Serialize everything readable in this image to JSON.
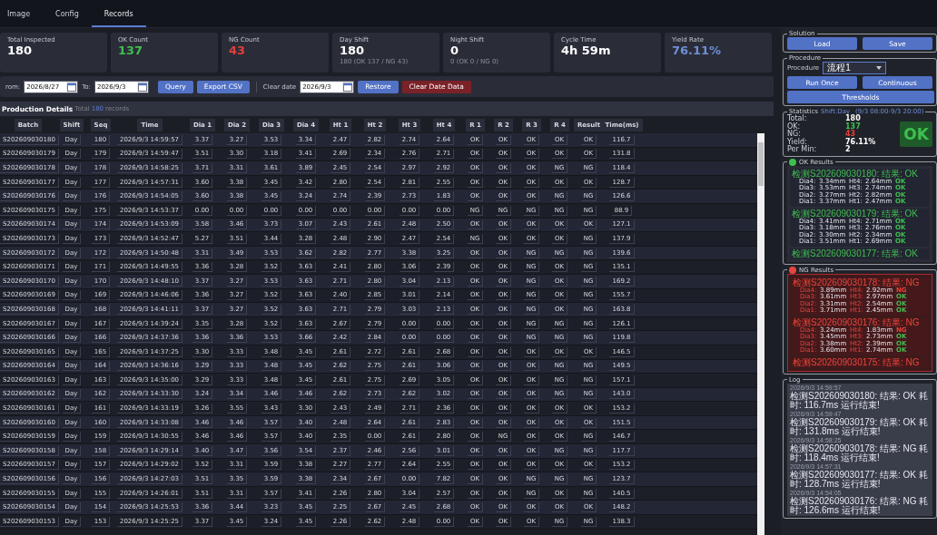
{
  "tabs": [
    {
      "label": "Image",
      "selected": false
    },
    {
      "label": "Config",
      "selected": false
    },
    {
      "label": "Records",
      "selected": true
    }
  ],
  "cards": [
    {
      "label": "Total Inspected",
      "value": "180",
      "kind": "plain"
    },
    {
      "label": "OK Count",
      "value": "137",
      "kind": "ok"
    },
    {
      "label": "NG Count",
      "value": "43",
      "kind": "ng"
    },
    {
      "label": "Day Shift",
      "value": "180",
      "sub": "180 (OK 137 / NG 43)",
      "kind": "plain"
    },
    {
      "label": "Night Shift",
      "value": "0",
      "sub": "0 (OK 0 / NG 0)",
      "kind": "plain"
    },
    {
      "label": "Cycle Time",
      "value": "4h 59m",
      "kind": "plain"
    },
    {
      "label": "Yield Rate",
      "value": "76.11%",
      "kind": "rate"
    }
  ],
  "filter": {
    "from_label": "rom:",
    "from": "2026/8/27",
    "to_label": "To:",
    "to": "2026/9/3",
    "query": "Query",
    "export": "Export CSV",
    "clear_label": "Clear date",
    "clear_date": "2026/9/3",
    "restore": "Restore",
    "clear": "Clear Date Data"
  },
  "details": {
    "title": "Production Details",
    "total_prefix": "Total",
    "total": "180",
    "total_suffix": "records"
  },
  "table": {
    "columns": [
      "Batch",
      "Shift",
      "Seq",
      "Time",
      "Dia 1",
      "Dia 2",
      "Dia 3",
      "Dia 4",
      "Ht 1",
      "Ht 2",
      "Ht 3",
      "Ht 4",
      "R 1",
      "R 2",
      "R 3",
      "R 4",
      "Result",
      "Time(ms)"
    ],
    "rows": [
      {
        "cells": [
          "S202609030180",
          "Day",
          "180",
          "2026/9/3 14:59:57",
          "3.37",
          "3.27",
          "3.53",
          "3.34",
          "2.47",
          "2.82",
          "2.74",
          "2.64",
          "OK",
          "OK",
          "OK",
          "OK",
          "OK",
          "116.7"
        ]
      },
      {
        "cells": [
          "S202609030179",
          "Day",
          "179",
          "2026/9/3 14:59:47",
          "3.51",
          "3.30",
          "3.18",
          "3.41",
          "2.69",
          "2.34",
          "2.76",
          "2.71",
          "OK",
          "OK",
          "OK",
          "OK",
          "OK",
          "131.8"
        ]
      },
      {
        "cells": [
          "S202609030178",
          "Day",
          "178",
          "2026/9/3 14:58:25",
          "3.71",
          "3.31",
          "3.61",
          "3.89",
          "2.45",
          "2.54",
          "2.97",
          "2.92",
          "OK",
          "OK",
          "OK",
          "NG",
          "NG",
          "118.4"
        ]
      },
      {
        "cells": [
          "S202609030177",
          "Day",
          "177",
          "2026/9/3 14:57:31",
          "3.60",
          "3.38",
          "3.45",
          "3.42",
          "2.80",
          "2.54",
          "2.81",
          "2.55",
          "OK",
          "OK",
          "OK",
          "OK",
          "OK",
          "128.7"
        ]
      },
      {
        "cells": [
          "S202609030176",
          "Day",
          "176",
          "2026/9/3 14:54:05",
          "3.60",
          "3.38",
          "3.45",
          "3.24",
          "2.74",
          "2.39",
          "2.73",
          "1.83",
          "OK",
          "OK",
          "OK",
          "NG",
          "NG",
          "126.6"
        ]
      },
      {
        "cells": [
          "S202609030175",
          "Day",
          "175",
          "2026/9/3 14:53:37",
          "0.00",
          "0.00",
          "0.00",
          "0.00",
          "0.00",
          "0.00",
          "0.00",
          "0.00",
          "NG",
          "NG",
          "NG",
          "NG",
          "NG",
          "88.9"
        ]
      },
      {
        "cells": [
          "S202609030174",
          "Day",
          "174",
          "2026/9/3 14:53:09",
          "3.58",
          "3.46",
          "3.73",
          "3.07",
          "2.43",
          "2.61",
          "2.48",
          "2.50",
          "OK",
          "OK",
          "OK",
          "OK",
          "OK",
          "127.1"
        ]
      },
      {
        "cells": [
          "S202609030173",
          "Day",
          "173",
          "2026/9/3 14:52:47",
          "5.27",
          "3.51",
          "3.44",
          "3.28",
          "2.48",
          "2.90",
          "2.47",
          "2.54",
          "NG",
          "OK",
          "OK",
          "OK",
          "NG",
          "137.9"
        ]
      },
      {
        "cells": [
          "S202609030172",
          "Day",
          "172",
          "2026/9/3 14:50:48",
          "3.31",
          "3.49",
          "3.53",
          "3.62",
          "2.82",
          "2.77",
          "3.38",
          "3.25",
          "OK",
          "OK",
          "NG",
          "NG",
          "NG",
          "139.6"
        ]
      },
      {
        "cells": [
          "S202609030171",
          "Day",
          "171",
          "2026/9/3 14:49:55",
          "3.36",
          "3.28",
          "3.52",
          "3.63",
          "2.41",
          "2.80",
          "3.06",
          "2.39",
          "OK",
          "OK",
          "NG",
          "OK",
          "NG",
          "135.1"
        ]
      },
      {
        "cells": [
          "S202609030170",
          "Day",
          "170",
          "2026/9/3 14:48:10",
          "3.37",
          "3.27",
          "3.53",
          "3.63",
          "2.71",
          "2.80",
          "3.04",
          "2.13",
          "OK",
          "OK",
          "NG",
          "OK",
          "NG",
          "169.2"
        ]
      },
      {
        "cells": [
          "S202609030169",
          "Day",
          "169",
          "2026/9/3 14:46:06",
          "3.36",
          "3.27",
          "3.52",
          "3.63",
          "2.40",
          "2.85",
          "3.01",
          "2.14",
          "OK",
          "OK",
          "NG",
          "OK",
          "NG",
          "155.7"
        ]
      },
      {
        "cells": [
          "S202609030168",
          "Day",
          "168",
          "2026/9/3 14:41:11",
          "3.37",
          "3.27",
          "3.52",
          "3.63",
          "2.71",
          "2.79",
          "3.03",
          "2.13",
          "OK",
          "OK",
          "NG",
          "OK",
          "NG",
          "163.8"
        ]
      },
      {
        "cells": [
          "S202609030167",
          "Day",
          "167",
          "2026/9/3 14:39:24",
          "3.35",
          "3.28",
          "3.52",
          "3.63",
          "2.67",
          "2.79",
          "0.00",
          "0.00",
          "OK",
          "OK",
          "NG",
          "NG",
          "NG",
          "126.1"
        ]
      },
      {
        "cells": [
          "S202609030166",
          "Day",
          "166",
          "2026/9/3 14:37:36",
          "3.36",
          "3.36",
          "3.53",
          "3.66",
          "2.42",
          "2.84",
          "0.00",
          "0.00",
          "OK",
          "OK",
          "NG",
          "NG",
          "NG",
          "119.8"
        ]
      },
      {
        "cells": [
          "S202609030165",
          "Day",
          "165",
          "2026/9/3 14:37:25",
          "3.30",
          "3.33",
          "3.48",
          "3.45",
          "2.61",
          "2.72",
          "2.61",
          "2.68",
          "OK",
          "OK",
          "OK",
          "OK",
          "OK",
          "146.5"
        ]
      },
      {
        "cells": [
          "S202609030164",
          "Day",
          "164",
          "2026/9/3 14:36:16",
          "3.29",
          "3.33",
          "3.48",
          "3.45",
          "2.62",
          "2.75",
          "2.61",
          "3.06",
          "OK",
          "OK",
          "OK",
          "NG",
          "NG",
          "149.5"
        ]
      },
      {
        "cells": [
          "S202609030163",
          "Day",
          "163",
          "2026/9/3 14:35:00",
          "3.29",
          "3.33",
          "3.48",
          "3.45",
          "2.61",
          "2.75",
          "2.69",
          "3.05",
          "OK",
          "OK",
          "OK",
          "NG",
          "NG",
          "157.1"
        ]
      },
      {
        "cells": [
          "S202609030162",
          "Day",
          "162",
          "2026/9/3 14:33:30",
          "3.24",
          "3.34",
          "3.46",
          "3.46",
          "2.62",
          "2.73",
          "2.62",
          "3.02",
          "OK",
          "OK",
          "OK",
          "NG",
          "NG",
          "143.0"
        ]
      },
      {
        "cells": [
          "S202609030161",
          "Day",
          "161",
          "2026/9/3 14:33:19",
          "3.26",
          "3.55",
          "3.43",
          "3.30",
          "2.43",
          "2.49",
          "2.71",
          "2.36",
          "OK",
          "OK",
          "OK",
          "OK",
          "OK",
          "153.2"
        ]
      },
      {
        "cells": [
          "S202609030160",
          "Day",
          "160",
          "2026/9/3 14:33:08",
          "3.46",
          "3.46",
          "3.57",
          "3.40",
          "2.48",
          "2.64",
          "2.61",
          "2.83",
          "OK",
          "OK",
          "OK",
          "OK",
          "OK",
          "151.5"
        ]
      },
      {
        "cells": [
          "S202609030159",
          "Day",
          "159",
          "2026/9/3 14:30:55",
          "3.46",
          "3.46",
          "3.57",
          "3.40",
          "2.35",
          "0.00",
          "2.61",
          "2.80",
          "OK",
          "NG",
          "OK",
          "OK",
          "NG",
          "146.7"
        ]
      },
      {
        "cells": [
          "S202609030158",
          "Day",
          "158",
          "2026/9/3 14:29:14",
          "3.40",
          "3.47",
          "3.56",
          "3.54",
          "2.37",
          "2.46",
          "2.56",
          "3.01",
          "OK",
          "OK",
          "OK",
          "NG",
          "NG",
          "117.7"
        ]
      },
      {
        "cells": [
          "S202609030157",
          "Day",
          "157",
          "2026/9/3 14:29:02",
          "3.52",
          "3.31",
          "3.59",
          "3.38",
          "2.27",
          "2.77",
          "2.64",
          "2.55",
          "OK",
          "OK",
          "OK",
          "OK",
          "OK",
          "153.2"
        ]
      },
      {
        "cells": [
          "S202609030156",
          "Day",
          "156",
          "2026/9/3 14:27:03",
          "3.51",
          "3.35",
          "3.59",
          "3.38",
          "2.34",
          "2.67",
          "0.00",
          "7.82",
          "OK",
          "OK",
          "NG",
          "NG",
          "NG",
          "123.7"
        ]
      },
      {
        "cells": [
          "S202609030155",
          "Day",
          "155",
          "2026/9/3 14:26:01",
          "3.51",
          "3.31",
          "3.57",
          "3.41",
          "2.26",
          "2.80",
          "3.04",
          "2.57",
          "OK",
          "OK",
          "NG",
          "OK",
          "NG",
          "140.5"
        ]
      },
      {
        "cells": [
          "S202609030154",
          "Day",
          "154",
          "2026/9/3 14:25:53",
          "3.36",
          "3.44",
          "3.23",
          "3.45",
          "2.25",
          "2.67",
          "2.45",
          "2.68",
          "OK",
          "OK",
          "OK",
          "OK",
          "OK",
          "148.2"
        ]
      },
      {
        "cells": [
          "S202609030153",
          "Day",
          "153",
          "2026/9/3 14:25:25",
          "3.37",
          "3.45",
          "3.24",
          "3.45",
          "2.26",
          "2.62",
          "2.48",
          "0.00",
          "OK",
          "OK",
          "OK",
          "NG",
          "NG",
          "138.3"
        ]
      }
    ]
  },
  "solution": {
    "title": "Solution",
    "buttons": [
      "Load",
      "Save"
    ]
  },
  "procedure": {
    "title": "Procedure",
    "label": "Procedure",
    "value": "流程1",
    "buttons": [
      "Run Once",
      "Continuous"
    ],
    "thresholds": "Thresholds"
  },
  "statistics": {
    "title": "Statistics",
    "shift": "Shift:Day",
    "range": "(9/3 08:00-9/3 20:00)",
    "rows": [
      {
        "label": "Total:",
        "value": "180",
        "kind": "plain"
      },
      {
        "label": "OK:",
        "value": "137",
        "kind": "ok"
      },
      {
        "label": "NG:",
        "value": "43",
        "kind": "ng"
      },
      {
        "label": "Yield:",
        "value": "76.11%",
        "kind": "plain"
      },
      {
        "label": "Per Min:",
        "value": "2",
        "kind": "plain"
      }
    ],
    "badge": {
      "text": "OK",
      "pass": true
    }
  },
  "ok_results": {
    "title": "OK Results",
    "pass": true,
    "entries": [
      {
        "header": "检测S202609030180: 结果: OK",
        "lines": [
          {
            "dl": "Dia4:",
            "d": "3.34mm",
            "hl": "Ht4:",
            "h": "2.64mm",
            "status": "OK",
            "pass": true
          },
          {
            "dl": "Dia3:",
            "d": "3.53mm",
            "hl": "Ht3:",
            "h": "2.74mm",
            "status": "OK",
            "pass": true
          },
          {
            "dl": "Dia2:",
            "d": "3.27mm",
            "hl": "Ht2:",
            "h": "2.82mm",
            "status": "OK",
            "pass": true
          },
          {
            "dl": "Dia1:",
            "d": "3.37mm",
            "hl": "Ht1:",
            "h": "2.47mm",
            "status": "OK",
            "pass": true
          }
        ]
      },
      {
        "header": "检测S202609030179: 结果: OK",
        "lines": [
          {
            "dl": "Dia4:",
            "d": "3.41mm",
            "hl": "Ht4:",
            "h": "2.71mm",
            "status": "OK",
            "pass": true
          },
          {
            "dl": "Dia3:",
            "d": "3.18mm",
            "hl": "Ht3:",
            "h": "2.76mm",
            "status": "OK",
            "pass": true
          },
          {
            "dl": "Dia2:",
            "d": "3.30mm",
            "hl": "Ht2:",
            "h": "2.34mm",
            "status": "OK",
            "pass": true
          },
          {
            "dl": "Dia1:",
            "d": "3.51mm",
            "hl": "Ht1:",
            "h": "2.69mm",
            "status": "OK",
            "pass": true
          }
        ]
      },
      {
        "header": "检测S202609030177: 结果: OK"
      }
    ]
  },
  "ng_results": {
    "title": "NG Results",
    "pass": false,
    "entries": [
      {
        "header": "检测S202609030178: 结果: NG",
        "lines": [
          {
            "dl": "Dia4:",
            "d": "3.89mm",
            "hl": "Ht4:",
            "h": "2.92mm",
            "status": "NG",
            "pass": false
          },
          {
            "dl": "Dia3:",
            "d": "3.61mm",
            "hl": "Ht3:",
            "h": "2.97mm",
            "status": "OK",
            "pass": true
          },
          {
            "dl": "Dia2:",
            "d": "3.31mm",
            "hl": "Ht2:",
            "h": "2.54mm",
            "status": "OK",
            "pass": true
          },
          {
            "dl": "Dia1:",
            "d": "3.71mm",
            "hl": "Ht1:",
            "h": "2.45mm",
            "status": "OK",
            "pass": true
          }
        ]
      },
      {
        "header": "检测S202609030176: 结果: NG",
        "lines": [
          {
            "dl": "Dia4:",
            "d": "3.24mm",
            "hl": "Ht4:",
            "h": "1.83mm",
            "status": "NG",
            "pass": false
          },
          {
            "dl": "Dia3:",
            "d": "3.45mm",
            "hl": "Ht3:",
            "h": "2.73mm",
            "status": "OK",
            "pass": true
          },
          {
            "dl": "Dia2:",
            "d": "3.38mm",
            "hl": "Ht2:",
            "h": "2.39mm",
            "status": "OK",
            "pass": true
          },
          {
            "dl": "Dia1:",
            "d": "3.60mm",
            "hl": "Ht1:",
            "h": "2.74mm",
            "status": "OK",
            "pass": true
          }
        ]
      },
      {
        "header": "检测S202609030175: 结果: NG"
      }
    ]
  },
  "log": {
    "title": "Log",
    "entries": [
      {
        "time": "2026/9/3 14:59:57",
        "message": "检测S202609030180: 结果: OK 耗时: 116.7ms 运行结束!"
      },
      {
        "time": "2026/9/3 14:59:47",
        "message": "检测S202609030179: 结果: OK 耗时: 131.8ms 运行结束!"
      },
      {
        "time": "2026/9/3 14:58:25",
        "message": "检测S202609030178: 结果: NG 耗时: 118.4ms 运行结束!"
      },
      {
        "time": "2026/9/3 14:57:31",
        "message": "检测S202609030177: 结果: OK 耗时: 128.7ms 运行结束!"
      },
      {
        "time": "2026/9/3 14:54:05",
        "message": "检测S202609030176: 结果: NG 耗时: 126.6ms 运行结束!"
      }
    ]
  }
}
